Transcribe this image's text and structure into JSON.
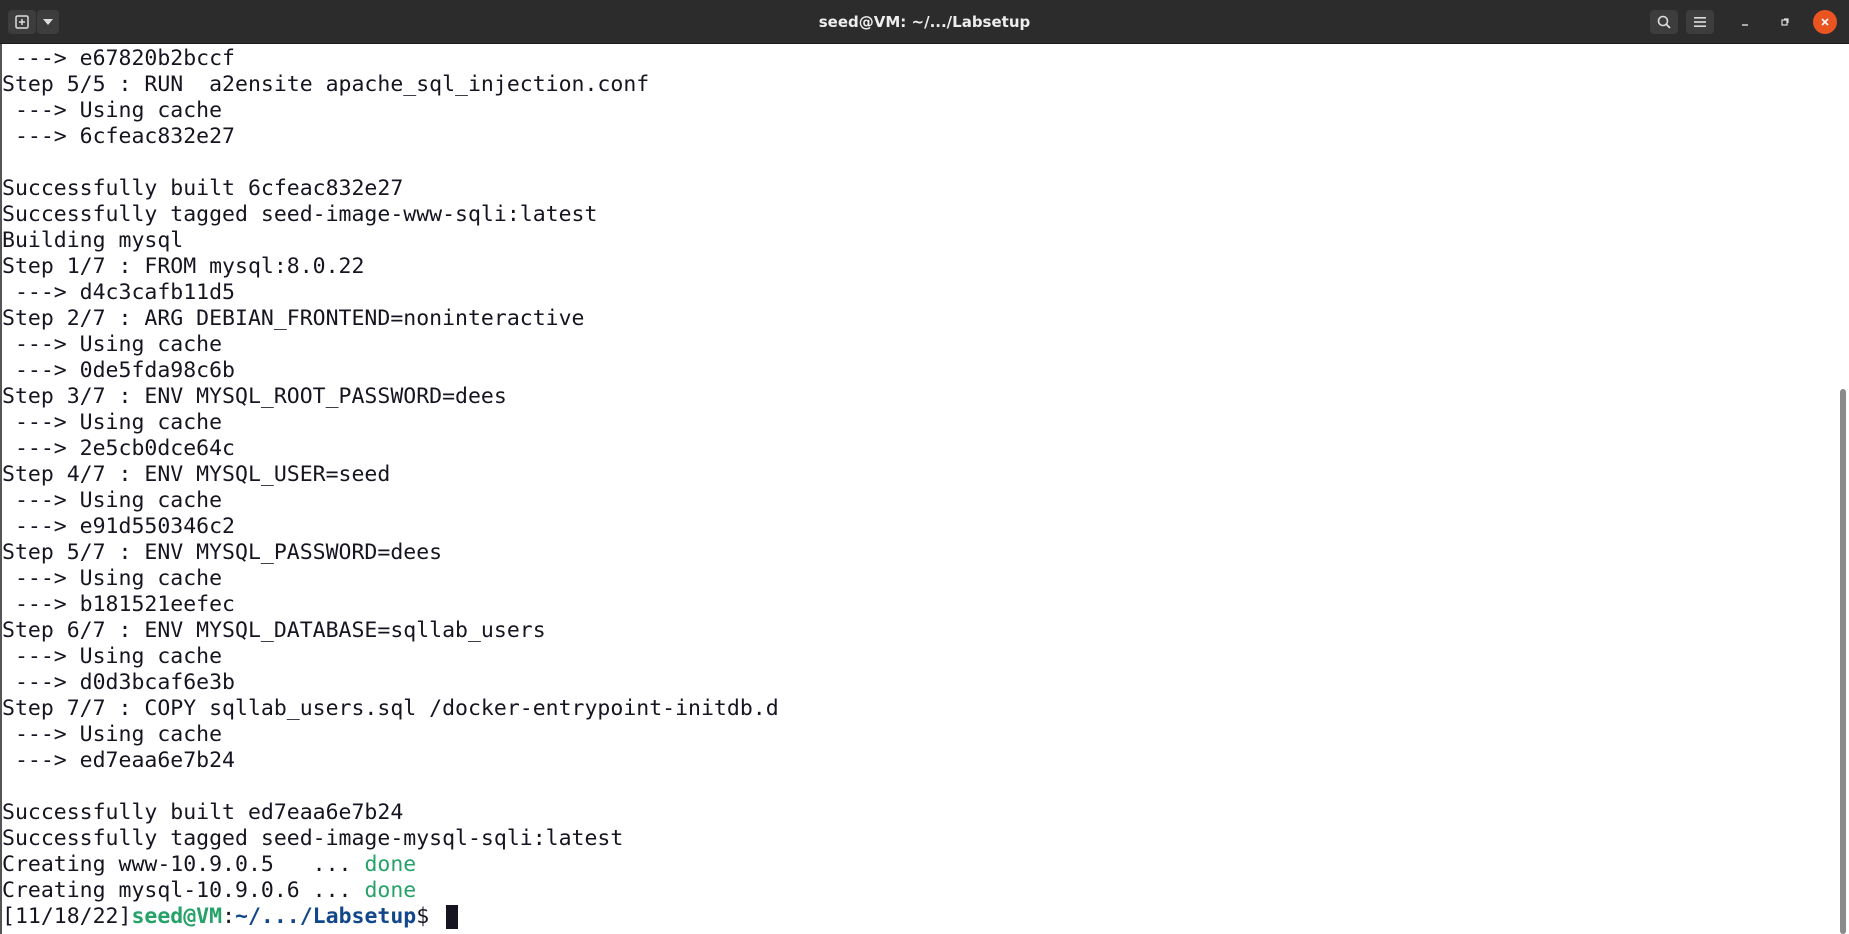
{
  "window": {
    "title": "seed@VM: ~/.../Labsetup",
    "icons": [
      "new-tab-icon",
      "dropdown-icon",
      "search-icon",
      "hamburger-menu-icon",
      "minimize-icon",
      "maximize-icon",
      "close-icon"
    ]
  },
  "terminal": {
    "lines": [
      " ---> e67820b2bccf",
      "Step 5/5 : RUN  a2ensite apache_sql_injection.conf",
      " ---> Using cache",
      " ---> 6cfeac832e27",
      "",
      "Successfully built 6cfeac832e27",
      "Successfully tagged seed-image-www-sqli:latest",
      "Building mysql",
      "Step 1/7 : FROM mysql:8.0.22",
      " ---> d4c3cafb11d5",
      "Step 2/7 : ARG DEBIAN_FRONTEND=noninteractive",
      " ---> Using cache",
      " ---> 0de5fda98c6b",
      "Step 3/7 : ENV MYSQL_ROOT_PASSWORD=dees",
      " ---> Using cache",
      " ---> 2e5cb0dce64c",
      "Step 4/7 : ENV MYSQL_USER=seed",
      " ---> Using cache",
      " ---> e91d550346c2",
      "Step 5/7 : ENV MYSQL_PASSWORD=dees",
      " ---> Using cache",
      " ---> b181521eefec",
      "Step 6/7 : ENV MYSQL_DATABASE=sqllab_users",
      " ---> Using cache",
      " ---> d0d3bcaf6e3b",
      "Step 7/7 : COPY sqllab_users.sql /docker-entrypoint-initdb.d",
      " ---> Using cache",
      " ---> ed7eaa6e7b24",
      "",
      "Successfully built ed7eaa6e7b24",
      "Successfully tagged seed-image-mysql-sqli:latest"
    ],
    "creating": [
      {
        "prefix": "Creating www-10.9.0.5   ... ",
        "status": "done"
      },
      {
        "prefix": "Creating mysql-10.9.0.6 ... ",
        "status": "done"
      }
    ],
    "prompt": {
      "date": "[11/18/22]",
      "user_host": "seed@VM",
      "sep": ":",
      "path": "~/.../Labsetup",
      "symbol": "$ "
    }
  },
  "colors": {
    "titlebar": "#2c2c2c",
    "close_button": "#e95420",
    "done_green": "#26a269",
    "prompt_user": "#26a269",
    "prompt_path": "#12488b"
  }
}
